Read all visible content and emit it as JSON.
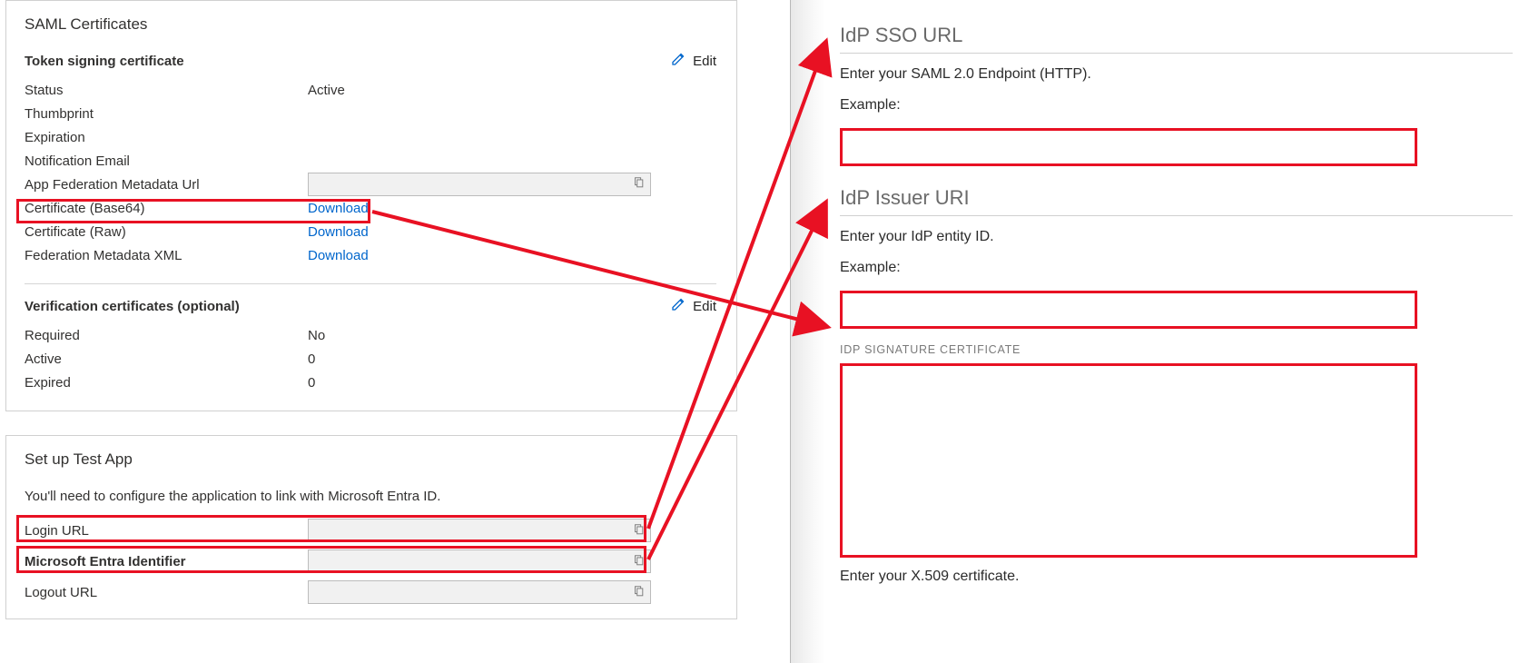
{
  "left": {
    "saml": {
      "title": "SAML Certificates",
      "edit_label": "Edit",
      "token_section": "Token signing certificate",
      "rows": {
        "status_label": "Status",
        "status_value": "Active",
        "thumbprint_label": "Thumbprint",
        "expiration_label": "Expiration",
        "notification_label": "Notification Email",
        "metadata_url_label": "App Federation Metadata Url",
        "cert_b64_label": "Certificate (Base64)",
        "cert_raw_label": "Certificate (Raw)",
        "fed_xml_label": "Federation Metadata XML",
        "download": "Download"
      },
      "verify_section": "Verification certificates (optional)",
      "verify_rows": {
        "required_label": "Required",
        "required_value": "No",
        "active_label": "Active",
        "active_value": "0",
        "expired_label": "Expired",
        "expired_value": "0"
      }
    },
    "setup": {
      "title": "Set up Test App",
      "desc": "You'll need to configure the application to link with Microsoft Entra ID.",
      "login_label": "Login URL",
      "entra_label": "Microsoft Entra Identifier",
      "logout_label": "Logout URL"
    }
  },
  "right": {
    "sso_title": "IdP SSO URL",
    "sso_desc": "Enter your SAML 2.0 Endpoint (HTTP).",
    "example": "Example:",
    "issuer_title": "IdP Issuer URI",
    "issuer_desc": "Enter your IdP entity ID.",
    "sigcert_label": "IDP SIGNATURE CERTIFICATE",
    "sigcert_desc": "Enter your X.509 certificate."
  }
}
